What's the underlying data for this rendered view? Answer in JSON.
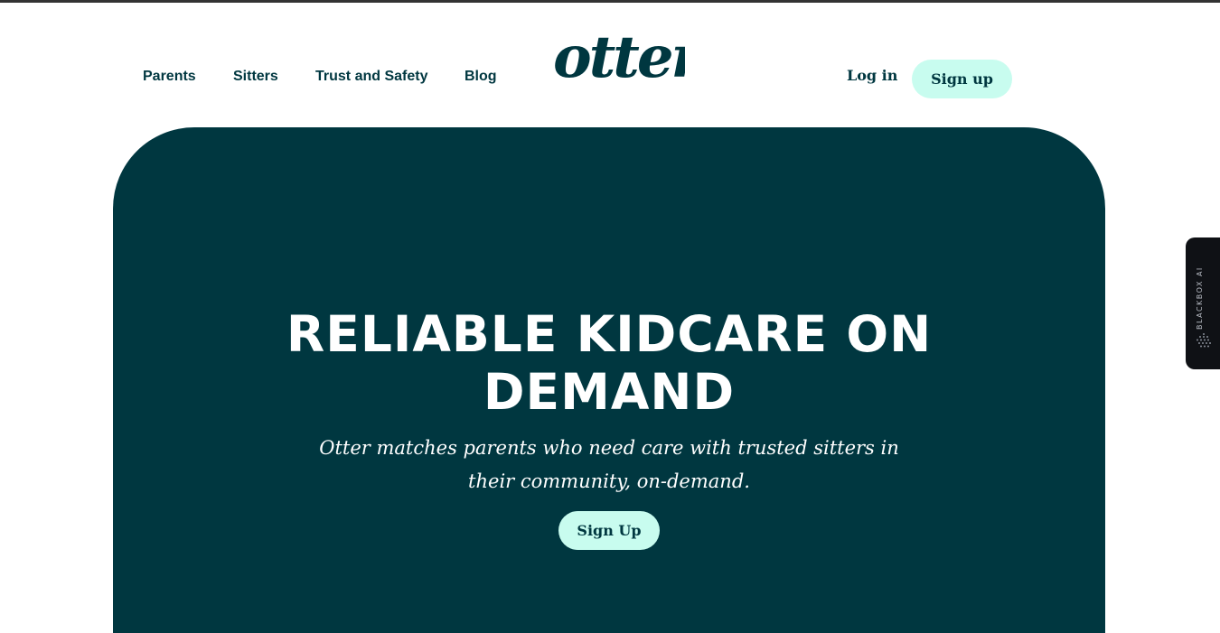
{
  "nav": {
    "links": [
      "Parents",
      "Sitters",
      "Trust and Safety",
      "Blog"
    ],
    "logo_text": "otter",
    "login_label": "Log in",
    "signup_label": "Sign up"
  },
  "hero": {
    "title_line1": "Reliable Kidcare on",
    "title_line2": "Demand",
    "subtitle": "Otter matches parents who need care with trusted sitters in their community, on-demand.",
    "cta_label": "Sign Up"
  },
  "side_widget": {
    "label": "BLACKBOX AI",
    "icon": "blackbox-dots-icon"
  },
  "colors": {
    "brand_dark": "#003740",
    "accent_mint": "#c8fcef",
    "background": "#ffffff"
  }
}
